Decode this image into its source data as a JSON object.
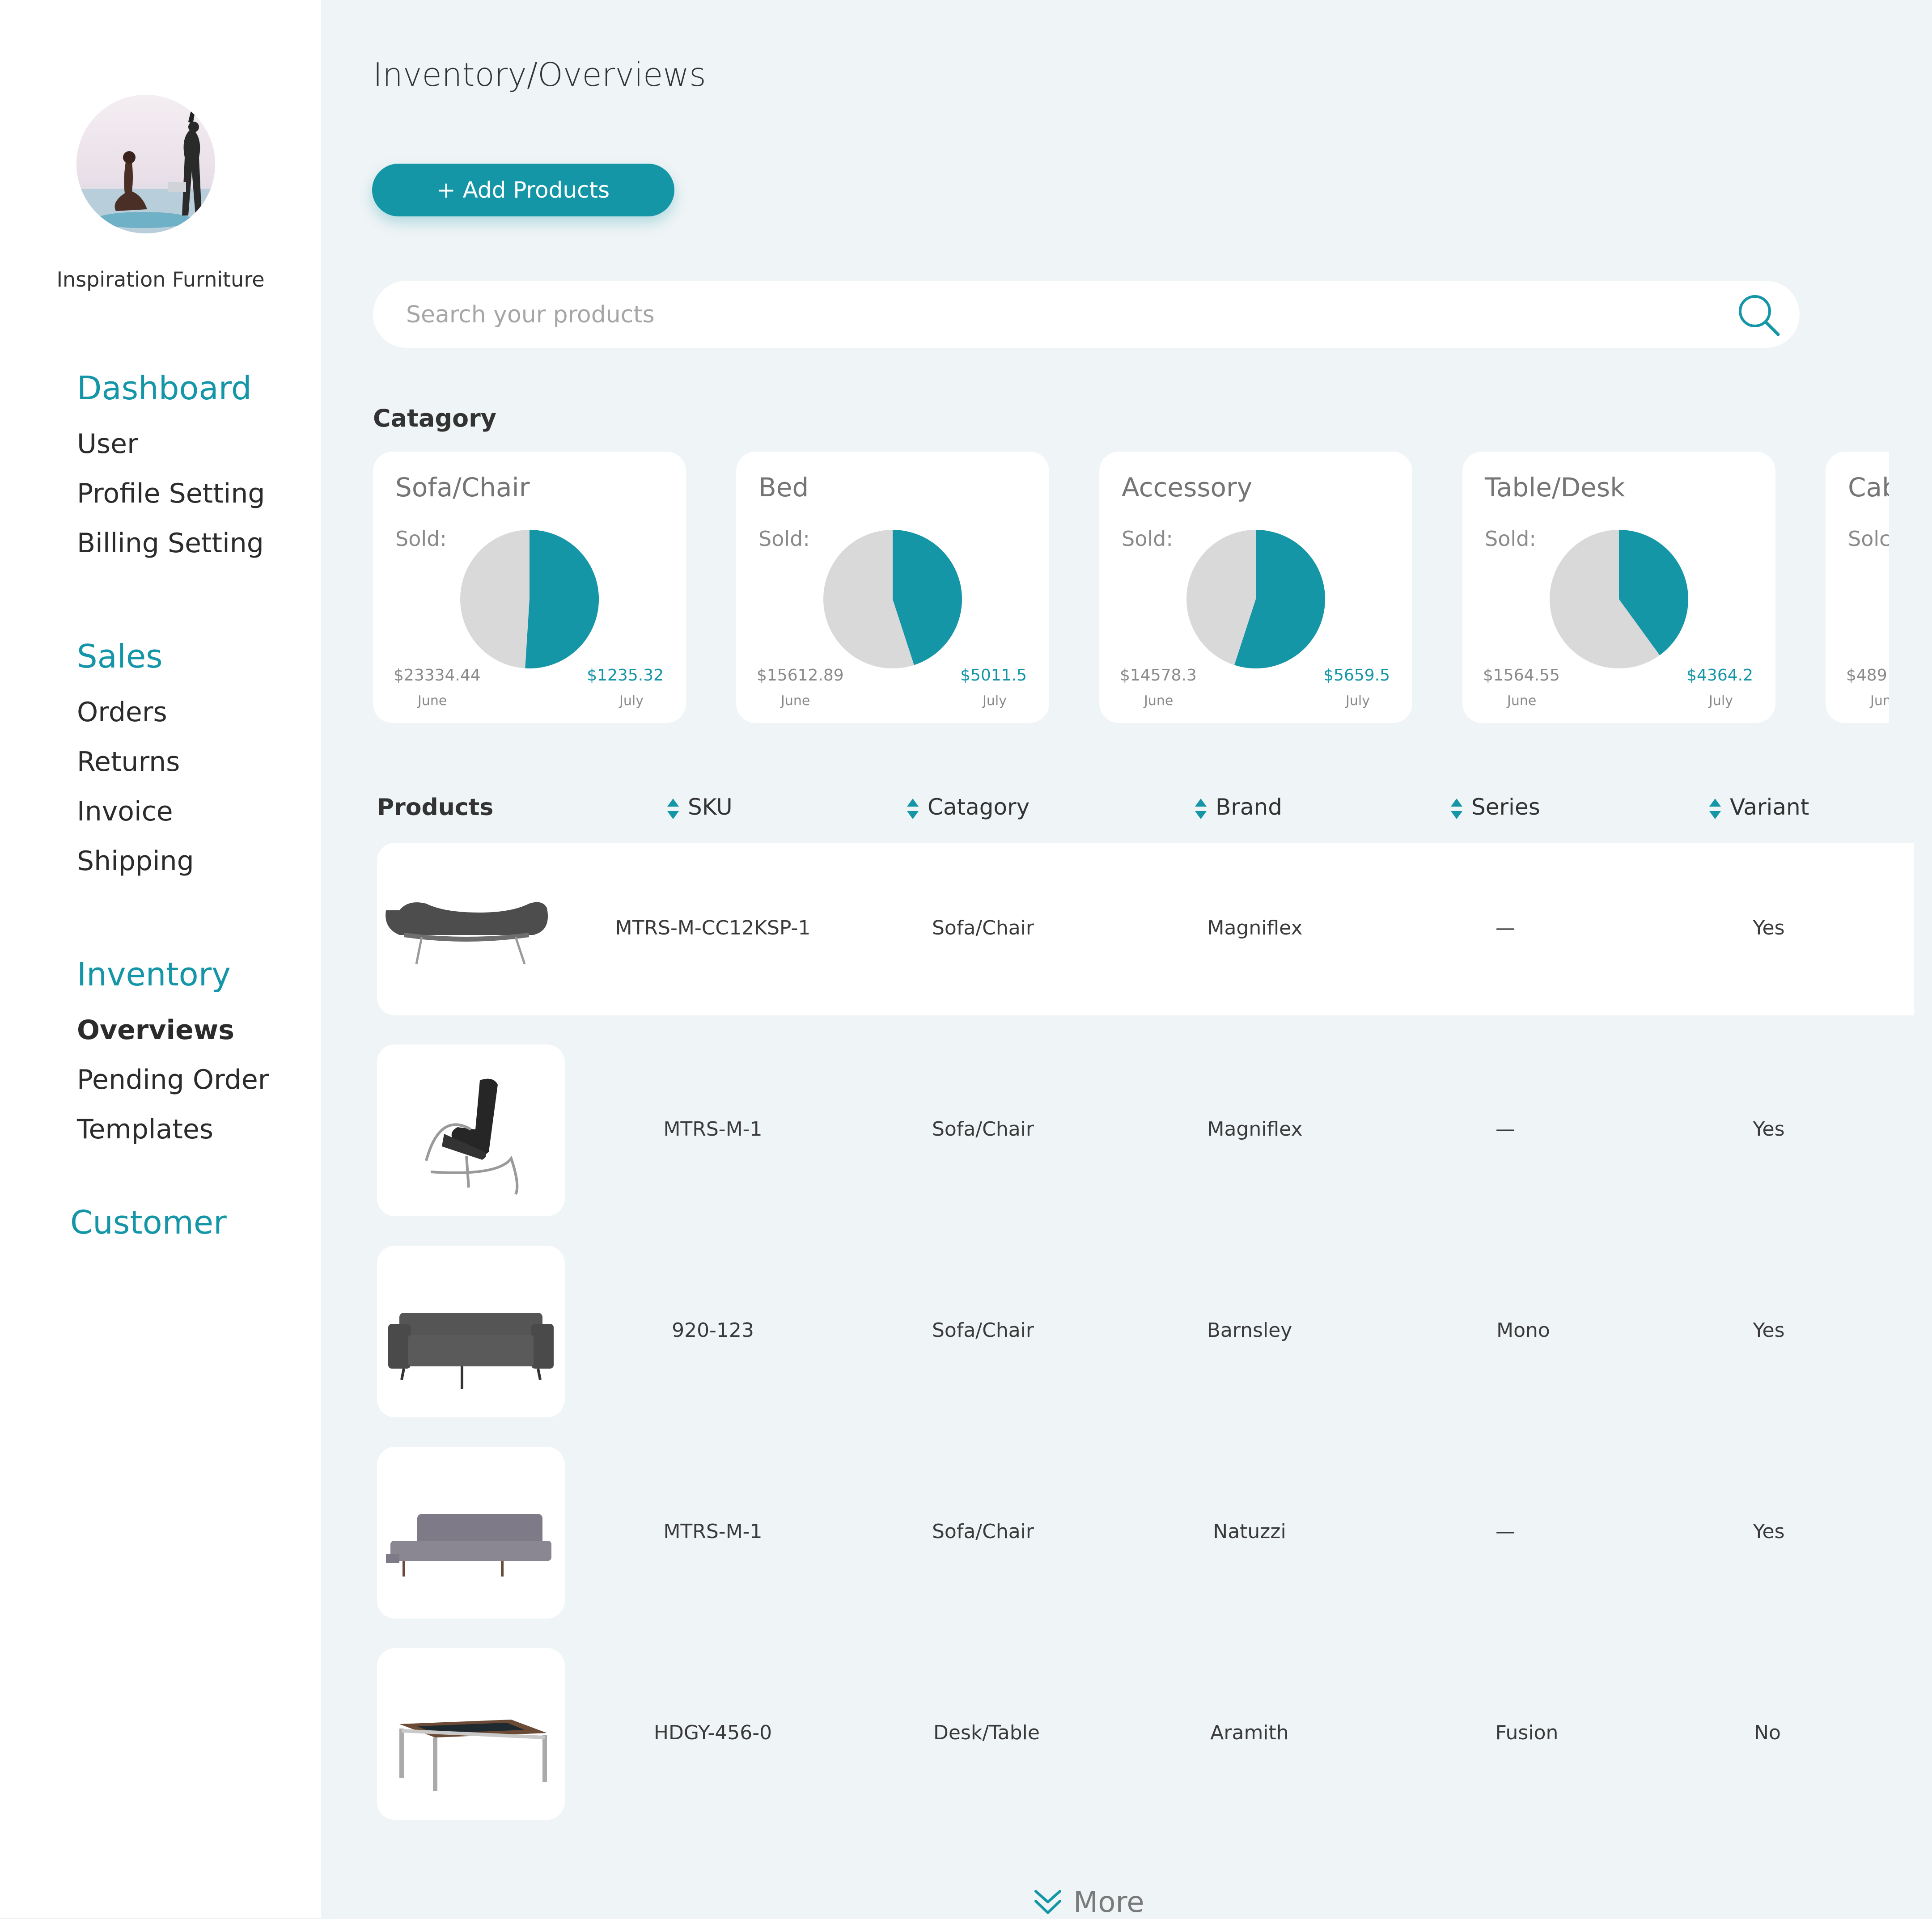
{
  "brand": {
    "name": "Inspiration Furniture"
  },
  "nav": {
    "dashboard": {
      "title": "Dashboard",
      "items": [
        "User",
        "Profile Setting",
        "Billing Setting"
      ]
    },
    "sales": {
      "title": "Sales",
      "items": [
        "Orders",
        "Returns",
        "Invoice",
        "Shipping"
      ]
    },
    "inventory": {
      "title": "Inventory",
      "items": [
        "Overviews",
        "Pending Order",
        "Templates"
      ]
    },
    "customer": {
      "title": "Customer"
    }
  },
  "page": {
    "title": "Inventory/Overviews",
    "add_button": "+ Add Products",
    "search_placeholder": "Search your products",
    "category_label": "Catagory",
    "more_label": "More"
  },
  "categories": [
    {
      "name": "Sofa/Chair",
      "sold_label": "Sold:",
      "june_value": "$23334.44",
      "july_value": "$1235.32",
      "june_label": "June",
      "july_label": "July",
      "july_share": 0.51
    },
    {
      "name": "Bed",
      "sold_label": "Sold:",
      "june_value": "$15612.89",
      "july_value": "$5011.5",
      "june_label": "June",
      "july_label": "July",
      "july_share": 0.45
    },
    {
      "name": "Accessory",
      "sold_label": "Sold:",
      "june_value": "$14578.3",
      "july_value": "$5659.5",
      "june_label": "June",
      "july_label": "July",
      "july_share": 0.55
    },
    {
      "name": "Table/Desk",
      "sold_label": "Sold:",
      "june_value": "$1564.55",
      "july_value": "$4364.2",
      "june_label": "June",
      "july_label": "July",
      "july_share": 0.4
    },
    {
      "name": "Cab",
      "sold_label": "Solc",
      "june_value": "$489",
      "june_label": "Jun"
    }
  ],
  "table": {
    "headers": {
      "products": "Products",
      "sku": "SKU",
      "category": "Catagory",
      "brand": "Brand",
      "series": "Series",
      "variant": "Variant"
    },
    "rows": [
      {
        "product_icon": "modern-sofa",
        "sku": "MTRS-M-CC12KSP-1",
        "category": "Sofa/Chair",
        "brand": "Magniflex",
        "series": "—",
        "variant": "Yes"
      },
      {
        "product_icon": "recliner-chair",
        "sku": "MTRS-M-1",
        "category": "Sofa/Chair",
        "brand": "Magniflex",
        "series": "—",
        "variant": "Yes"
      },
      {
        "product_icon": "grey-sofa",
        "sku": "920-123",
        "category": "Sofa/Chair",
        "brand": "Barnsley",
        "series": "Mono",
        "variant": "Yes"
      },
      {
        "product_icon": "sofa-bed",
        "sku": "MTRS-M-1",
        "category": "Sofa/Chair",
        "brand": "Natuzzi",
        "series": "—",
        "variant": "Yes"
      },
      {
        "product_icon": "pool-dining-table",
        "sku": "HDGY-456-0",
        "category": "Desk/Table",
        "brand": "Aramith",
        "series": "Fusion",
        "variant": "No"
      }
    ]
  },
  "colors": {
    "accent": "#1496a7",
    "pie_rest": "#d9d9d9",
    "sidebar_bg": "#ffffff",
    "main_bg": "#eff4f6"
  }
}
